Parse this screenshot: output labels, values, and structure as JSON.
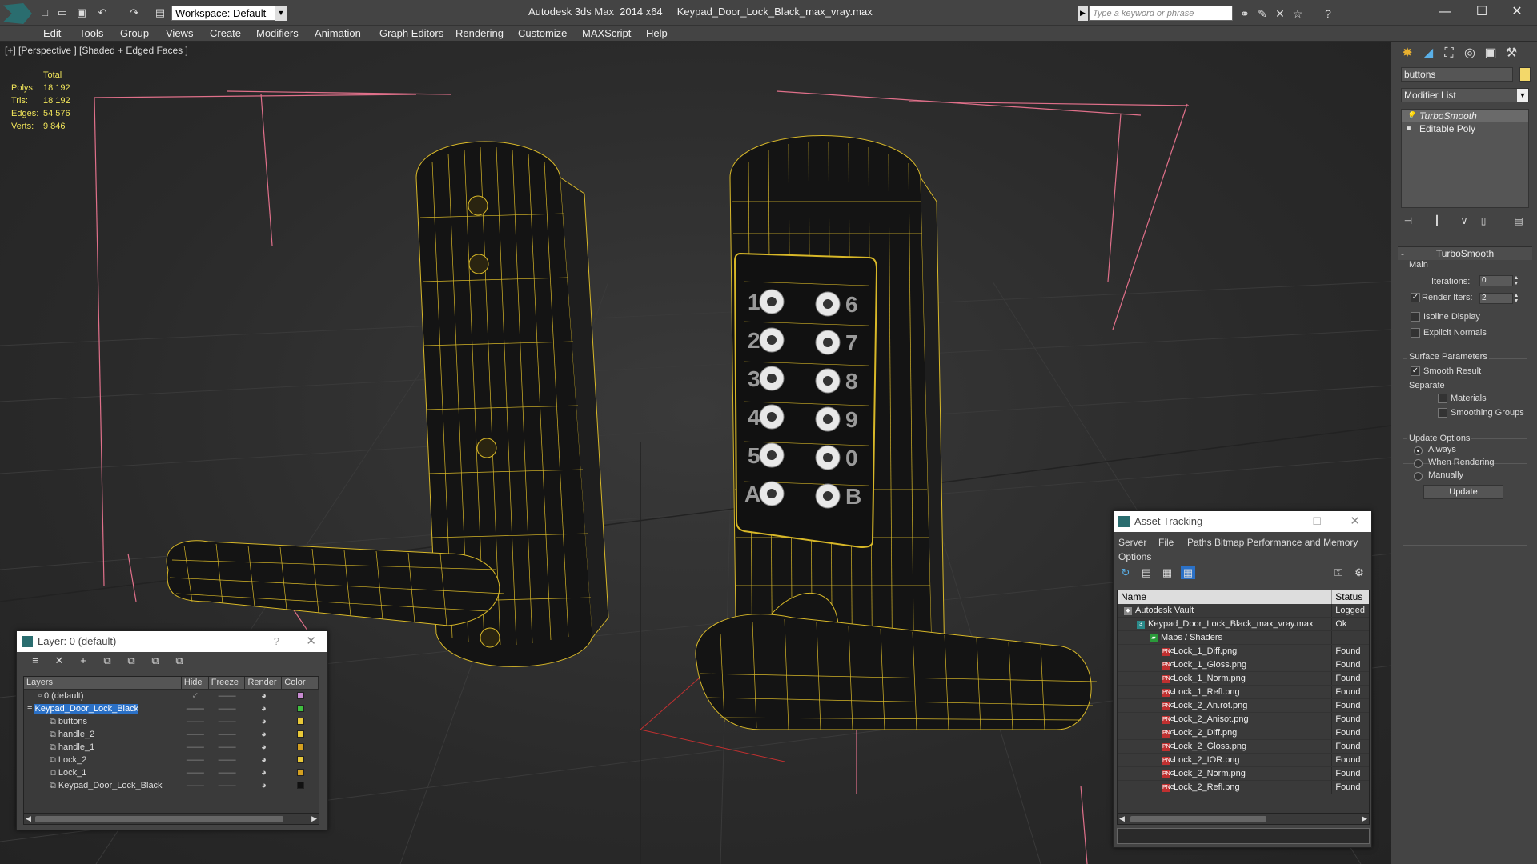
{
  "titlebar": {
    "workspace": "Workspace: Default",
    "app_title": "Autodesk 3ds Max  2014 x64     Keypad_Door_Lock_Black_max_vray.max",
    "search_placeholder": "Type a keyword or phrase"
  },
  "menu": [
    "Edit",
    "Tools",
    "Group",
    "Views",
    "Create",
    "Modifiers",
    "Animation",
    "Graph Editors",
    "Rendering",
    "Customize",
    "MAXScript",
    "Help"
  ],
  "viewport": {
    "label": "[+] [Perspective ] [Shaded + Edged Faces ]",
    "stats": {
      "header": "Total",
      "rows": [
        {
          "k": "Polys:",
          "v": "18 192"
        },
        {
          "k": "Tris:",
          "v": "18 192"
        },
        {
          "k": "Edges:",
          "v": "54 576"
        },
        {
          "k": "Verts:",
          "v": "9 846"
        }
      ]
    },
    "keypad_digits_left": [
      "1",
      "2",
      "3",
      "4",
      "5",
      "A"
    ],
    "keypad_digits_right": [
      "6",
      "7",
      "8",
      "9",
      "0",
      "B"
    ],
    "wire_color": "#d8b828"
  },
  "command_panel": {
    "object_name": "buttons",
    "object_color": "#f3d86a",
    "modifier_list": "Modifier List",
    "stack": [
      "TurboSmooth",
      "Editable Poly"
    ],
    "rollout_title": "TurboSmooth",
    "main_group": "Main",
    "iterations_label": "Iterations:",
    "iterations_value": "0",
    "render_iters_label": "Render Iters:",
    "render_iters_value": "2",
    "isoline_label": "Isoline Display",
    "explicit_normals_label": "Explicit Normals",
    "surface_group": "Surface Parameters",
    "smooth_result_label": "Smooth Result",
    "separate_label": "Separate",
    "materials_label": "Materials",
    "smoothing_groups_label": "Smoothing Groups",
    "update_group": "Update Options",
    "always_label": "Always",
    "when_rendering_label": "When Rendering",
    "manually_label": "Manually",
    "update_button": "Update"
  },
  "layer_window": {
    "title": "Layer: 0 (default)",
    "help": "?",
    "columns": [
      "Layers",
      "Hide",
      "Freeze",
      "Render",
      "Color"
    ],
    "rows": [
      {
        "name": "0 (default)",
        "indent": 1,
        "color": "#c78ad0",
        "check": true
      },
      {
        "name": "Keypad_Door_Lock_Black",
        "indent": 0,
        "color": "#3fbf3f",
        "selected": true
      },
      {
        "name": "buttons",
        "indent": 2,
        "color": "#e8c838"
      },
      {
        "name": "handle_2",
        "indent": 2,
        "color": "#e8c838"
      },
      {
        "name": "handle_1",
        "indent": 2,
        "color": "#d4a020"
      },
      {
        "name": "Lock_2",
        "indent": 2,
        "color": "#e8c838"
      },
      {
        "name": "Lock_1",
        "indent": 2,
        "color": "#d4a020"
      },
      {
        "name": "Keypad_Door_Lock_Black",
        "indent": 2,
        "color": "#111111"
      }
    ]
  },
  "asset_window": {
    "title": "Asset Tracking",
    "menu": [
      "Server",
      "File",
      "Paths",
      "Bitmap Performance and Memory",
      "Options"
    ],
    "columns": [
      "Name",
      "Status"
    ],
    "rows": [
      {
        "name": "Autodesk Vault",
        "status": "Logged",
        "indent": 0,
        "icon": "vault"
      },
      {
        "name": "Keypad_Door_Lock_Black_max_vray.max",
        "status": "Ok",
        "indent": 1,
        "icon": "max"
      },
      {
        "name": "Maps / Shaders",
        "status": "",
        "indent": 2,
        "icon": "folder"
      },
      {
        "name": "Lock_1_Diff.png",
        "status": "Found",
        "indent": 3,
        "icon": "png"
      },
      {
        "name": "Lock_1_Gloss.png",
        "status": "Found",
        "indent": 3,
        "icon": "png"
      },
      {
        "name": "Lock_1_Norm.png",
        "status": "Found",
        "indent": 3,
        "icon": "png"
      },
      {
        "name": "Lock_1_Refl.png",
        "status": "Found",
        "indent": 3,
        "icon": "png"
      },
      {
        "name": "Lock_2_An.rot.png",
        "status": "Found",
        "indent": 3,
        "icon": "png"
      },
      {
        "name": "Lock_2_Anisot.png",
        "status": "Found",
        "indent": 3,
        "icon": "png"
      },
      {
        "name": "Lock_2_Diff.png",
        "status": "Found",
        "indent": 3,
        "icon": "png"
      },
      {
        "name": "Lock_2_Gloss.png",
        "status": "Found",
        "indent": 3,
        "icon": "png"
      },
      {
        "name": "Lock_2_IOR.png",
        "status": "Found",
        "indent": 3,
        "icon": "png"
      },
      {
        "name": "Lock_2_Norm.png",
        "status": "Found",
        "indent": 3,
        "icon": "png"
      },
      {
        "name": "Lock_2_Refl.png",
        "status": "Found",
        "indent": 3,
        "icon": "png"
      }
    ]
  }
}
